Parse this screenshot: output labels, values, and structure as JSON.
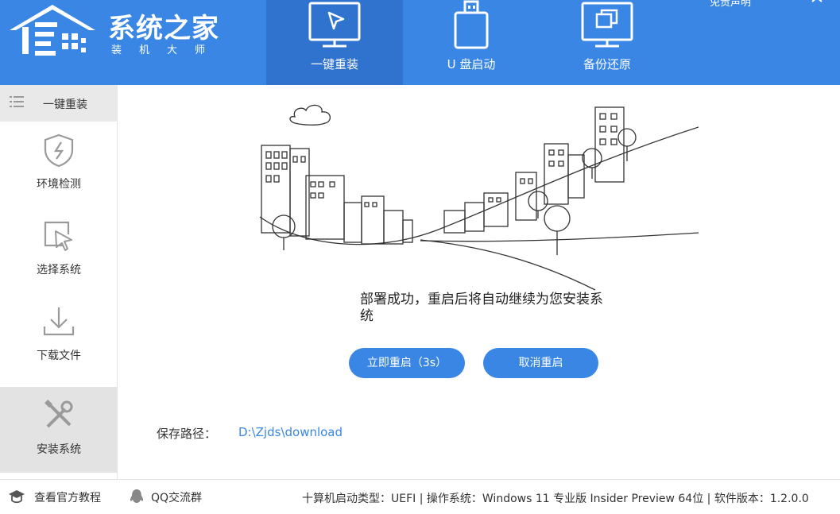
{
  "app": {
    "title": "系统之家",
    "subtitle": "装机大师"
  },
  "header": {
    "tabs": [
      {
        "label": "一键重装",
        "icon": "cursor-monitor-icon",
        "active": true
      },
      {
        "label": "U 盘启动",
        "icon": "usb-drive-icon",
        "active": false
      },
      {
        "label": "备份还原",
        "icon": "backup-monitor-icon",
        "active": false
      }
    ],
    "disclaimer": "免责声明"
  },
  "sidebar": {
    "header_label": "一键重装",
    "items": [
      {
        "label": "环境检测",
        "icon": "shield-icon",
        "active": false
      },
      {
        "label": "选择系统",
        "icon": "select-cursor-icon",
        "active": false
      },
      {
        "label": "下载文件",
        "icon": "download-icon",
        "active": false
      },
      {
        "label": "安装系统",
        "icon": "tools-icon",
        "active": true
      }
    ]
  },
  "main": {
    "message": "部署成功，重启后将自动继续为您安装系统",
    "reboot_button": "立即重启（3s）",
    "cancel_button": "取消重启",
    "save_path_label": "保存路径：",
    "save_path_value": "D:\\Zjds\\download"
  },
  "footer": {
    "tutorial_link": "查看官方教程",
    "qq_link": "QQ交流群",
    "info": "十算机启动类型：UEFI | 操作系统：Windows 11 专业版 Insider Preview 64位 | 软件版本：1.2.0.0"
  },
  "colors": {
    "accent": "#3a86e4",
    "header_active": "#2f73cf",
    "sidebar_active": "#e3e3e3"
  }
}
